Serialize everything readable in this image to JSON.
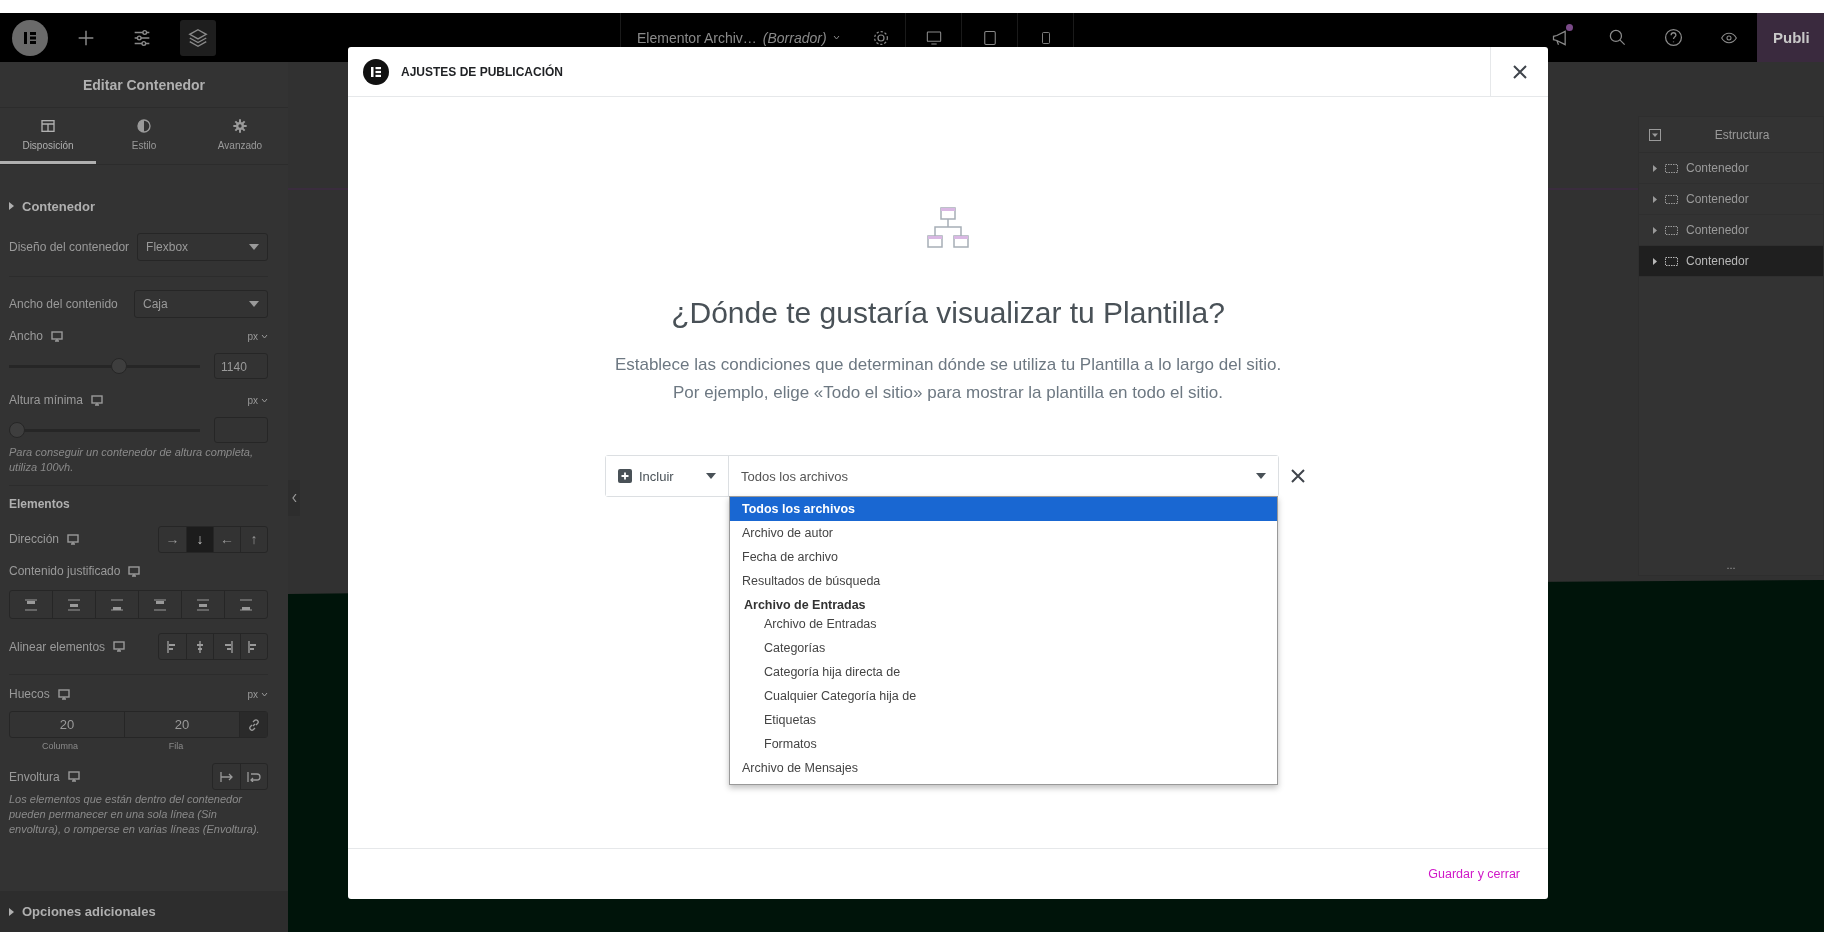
{
  "top_bar": {
    "tools": [
      {
        "kind": "add",
        "selected": false
      },
      {
        "kind": "sliders",
        "selected": false
      },
      {
        "kind": "layers",
        "selected": true
      }
    ],
    "document_title": "Elementor Archiv…",
    "document_status": "(Borrador)",
    "notifications_unread": true,
    "publish_button": "Publi"
  },
  "left_panel": {
    "title": "Editar Contenedor",
    "tabs": [
      {
        "kind": "layout",
        "label": "Disposición",
        "selected": true
      },
      {
        "kind": "style",
        "label": "Estilo",
        "selected": false
      },
      {
        "kind": "advanced",
        "label": "Avanzado",
        "selected": false
      }
    ],
    "section": "Contenedor",
    "container_layout": {
      "label": "Diseño del contenedor",
      "value": "Flexbox"
    },
    "content_width": {
      "label": "Ancho del contenido",
      "value": "Caja"
    },
    "width": {
      "label": "Ancho",
      "unit": "px",
      "level": 0.58,
      "value": "1140"
    },
    "min_height": {
      "label": "Altura mínima",
      "unit": "px",
      "level": 0,
      "hint": "Para conseguir un contenedor de altura completa, utiliza 100vh."
    },
    "items_section": "Elementos",
    "direction": {
      "label": "Dirección",
      "options": [
        {
          "glyph": "→",
          "selected": false
        },
        {
          "glyph": "↓",
          "selected": true
        },
        {
          "glyph": "←",
          "selected": false
        },
        {
          "glyph": "↑",
          "selected": false
        }
      ]
    },
    "justify_content": {
      "label": "Contenido justificado"
    },
    "align_items": {
      "label": "Alinear elementos"
    },
    "gaps": {
      "label": "Huecos",
      "unit": "px",
      "column": "20",
      "row": "20",
      "column_label": "Columna",
      "row_label": "Fila"
    },
    "wrap": {
      "label": "Envoltura",
      "hint": "Los elementos que están dentro del contenedor pueden permanecer en una sola línea (Sin envoltura), o romperse en varias líneas (Envoltura)."
    },
    "additional_section": "Opciones adicionales"
  },
  "structure_panel": {
    "title": "Estructura",
    "items": [
      {
        "label": "Contenedor",
        "selected": false
      },
      {
        "label": "Contenedor",
        "selected": false
      },
      {
        "label": "Contenedor",
        "selected": false
      },
      {
        "label": "Contenedor",
        "selected": true
      }
    ],
    "footer": "..."
  },
  "modal": {
    "title": "AJUSTES DE PUBLICACIÓN",
    "heading": "¿Dónde te gustaría visualizar tu Plantilla?",
    "description": [
      "Establece las condiciones que determinan dónde se utiliza tu Plantilla a lo largo del sitio.",
      "Por ejemplo, elige «Todo el sitio» para mostrar la plantilla en todo el sitio."
    ],
    "condition": {
      "type": "Incluir",
      "value": "Todos los archivos",
      "options": [
        {
          "kind": "option",
          "label": "Todos los archivos",
          "selected": true
        },
        {
          "kind": "option",
          "label": "Archivo de autor",
          "selected": false
        },
        {
          "kind": "option",
          "label": "Fecha de archivo",
          "selected": false
        },
        {
          "kind": "option",
          "label": "Resultados de búsqueda",
          "selected": false
        },
        {
          "kind": "group",
          "label": "Archivo de Entradas",
          "children": [
            {
              "label": "Archivo de Entradas",
              "selected": false
            },
            {
              "label": "Categorías",
              "selected": false
            },
            {
              "label": "Categoría hija directa de",
              "selected": false
            },
            {
              "label": "Cualquier Categoría hija de",
              "selected": false
            },
            {
              "label": "Etiquetas",
              "selected": false
            },
            {
              "label": "Formatos",
              "selected": false
            }
          ]
        },
        {
          "kind": "option",
          "label": "Archivo de Mensajes",
          "selected": false
        }
      ]
    },
    "save_button": "Guardar y cerrar"
  }
}
